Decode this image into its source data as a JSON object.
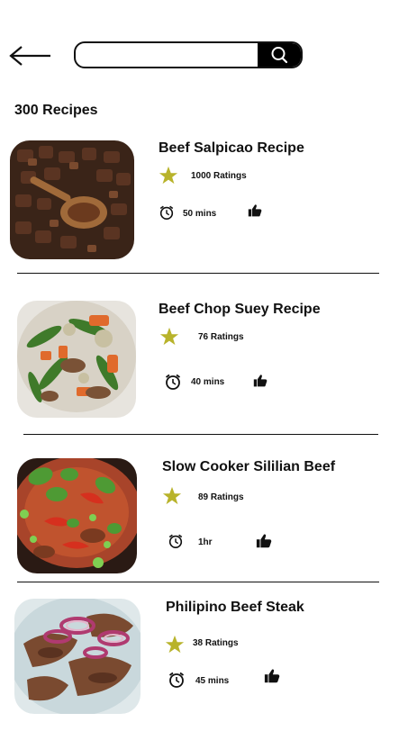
{
  "header": {
    "search": {
      "value": "",
      "placeholder": ""
    }
  },
  "summary": {
    "count_label": "300 Recipes"
  },
  "icons": {
    "back": "arrow-left-icon",
    "search": "search-icon",
    "rating": "star-icon",
    "time": "alarm-clock-icon",
    "like": "thumbs-up-icon"
  },
  "colors": {
    "star": "#b8b32b",
    "search_button": "#000000"
  },
  "recipes": [
    {
      "title": "Beef Salpicao Recipe",
      "ratings": "1000 Ratings",
      "time": "50 mins",
      "image": "beef-salpicao-photo"
    },
    {
      "title": "Beef Chop Suey Recipe",
      "ratings": "76 Ratings",
      "time": "40 mins",
      "image": "beef-chop-suey-photo"
    },
    {
      "title": "Slow Cooker Sililian Beef",
      "ratings": "89 Ratings",
      "time": "1hr",
      "image": "slow-cooker-beef-photo"
    },
    {
      "title": "Philipino Beef Steak",
      "ratings": "38 Ratings",
      "time": "45 mins",
      "image": "beef-steak-photo"
    }
  ]
}
